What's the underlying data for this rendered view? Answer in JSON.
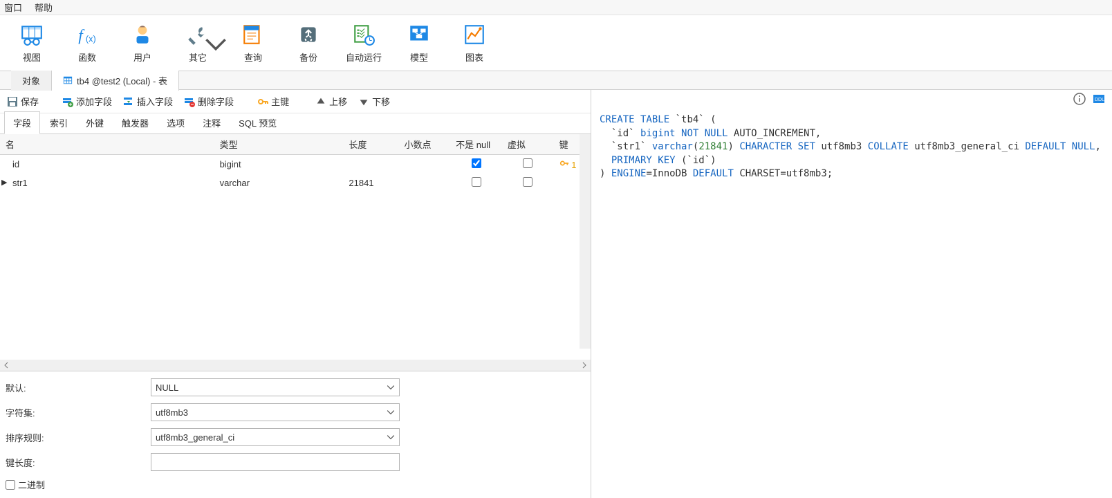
{
  "menubar": {
    "window": "窗口",
    "help": "帮助"
  },
  "ribbon": {
    "view": "视图",
    "function": "函数",
    "user": "用户",
    "other": "其它",
    "query": "查询",
    "backup": "备份",
    "autorun": "自动运行",
    "model": "模型",
    "chart": "图表"
  },
  "tabs": {
    "objects": "对象",
    "editor": "tb4 @test2 (Local) - 表"
  },
  "toolbar2": {
    "save": "保存",
    "addfield": "添加字段",
    "insertfield": "插入字段",
    "deletefield": "删除字段",
    "primarykey": "主键",
    "moveup": "上移",
    "movedown": "下移"
  },
  "subtabs": {
    "fields": "字段",
    "indexes": "索引",
    "fks": "外键",
    "triggers": "触发器",
    "options": "选项",
    "comment": "注释",
    "sqlpreview": "SQL 预览"
  },
  "columns": {
    "name": "名",
    "type": "类型",
    "length": "长度",
    "decimals": "小数点",
    "notnull": "不是 null",
    "virtual": "虚拟",
    "key": "键"
  },
  "rows": [
    {
      "name": "id",
      "type": "bigint",
      "length": "",
      "decimals": "",
      "notnull": true,
      "virtual": false,
      "key": "1"
    },
    {
      "name": "str1",
      "type": "varchar",
      "length": "21841",
      "decimals": "",
      "notnull": false,
      "virtual": false,
      "key": ""
    }
  ],
  "props": {
    "default_label": "默认:",
    "default_value": "NULL",
    "charset_label": "字符集:",
    "charset_value": "utf8mb3",
    "collation_label": "排序规则:",
    "collation_value": "utf8mb3_general_ci",
    "keylen_label": "键长度:",
    "binary_label": "二进制"
  },
  "ddl": {
    "l1a": "CREATE TABLE",
    "l1b": " `tb4` (",
    "l2a": "  `id` ",
    "l2b": "bigint NOT NULL",
    "l2c": " AUTO_INCREMENT,",
    "l3a": "  `str1` ",
    "l3b": "varchar",
    "l3c": "(",
    "l3d": "21841",
    "l3e": ") ",
    "l3f": "CHARACTER SET",
    "l3g": " utf8mb3 ",
    "l3h": "COLLATE",
    "l3i": " utf8mb3_general_ci ",
    "l3j": "DEFAULT NULL",
    "l3k": ",",
    "l4a": "  PRIMARY KEY",
    "l4b": " (`id`)",
    "l5a": ") ",
    "l5b": "ENGINE",
    "l5c": "=InnoDB ",
    "l5d": "DEFAULT",
    "l5e": " CHARSET=utf8mb3;"
  },
  "right_icons": {
    "info": "i",
    "ddl": "DDL"
  }
}
